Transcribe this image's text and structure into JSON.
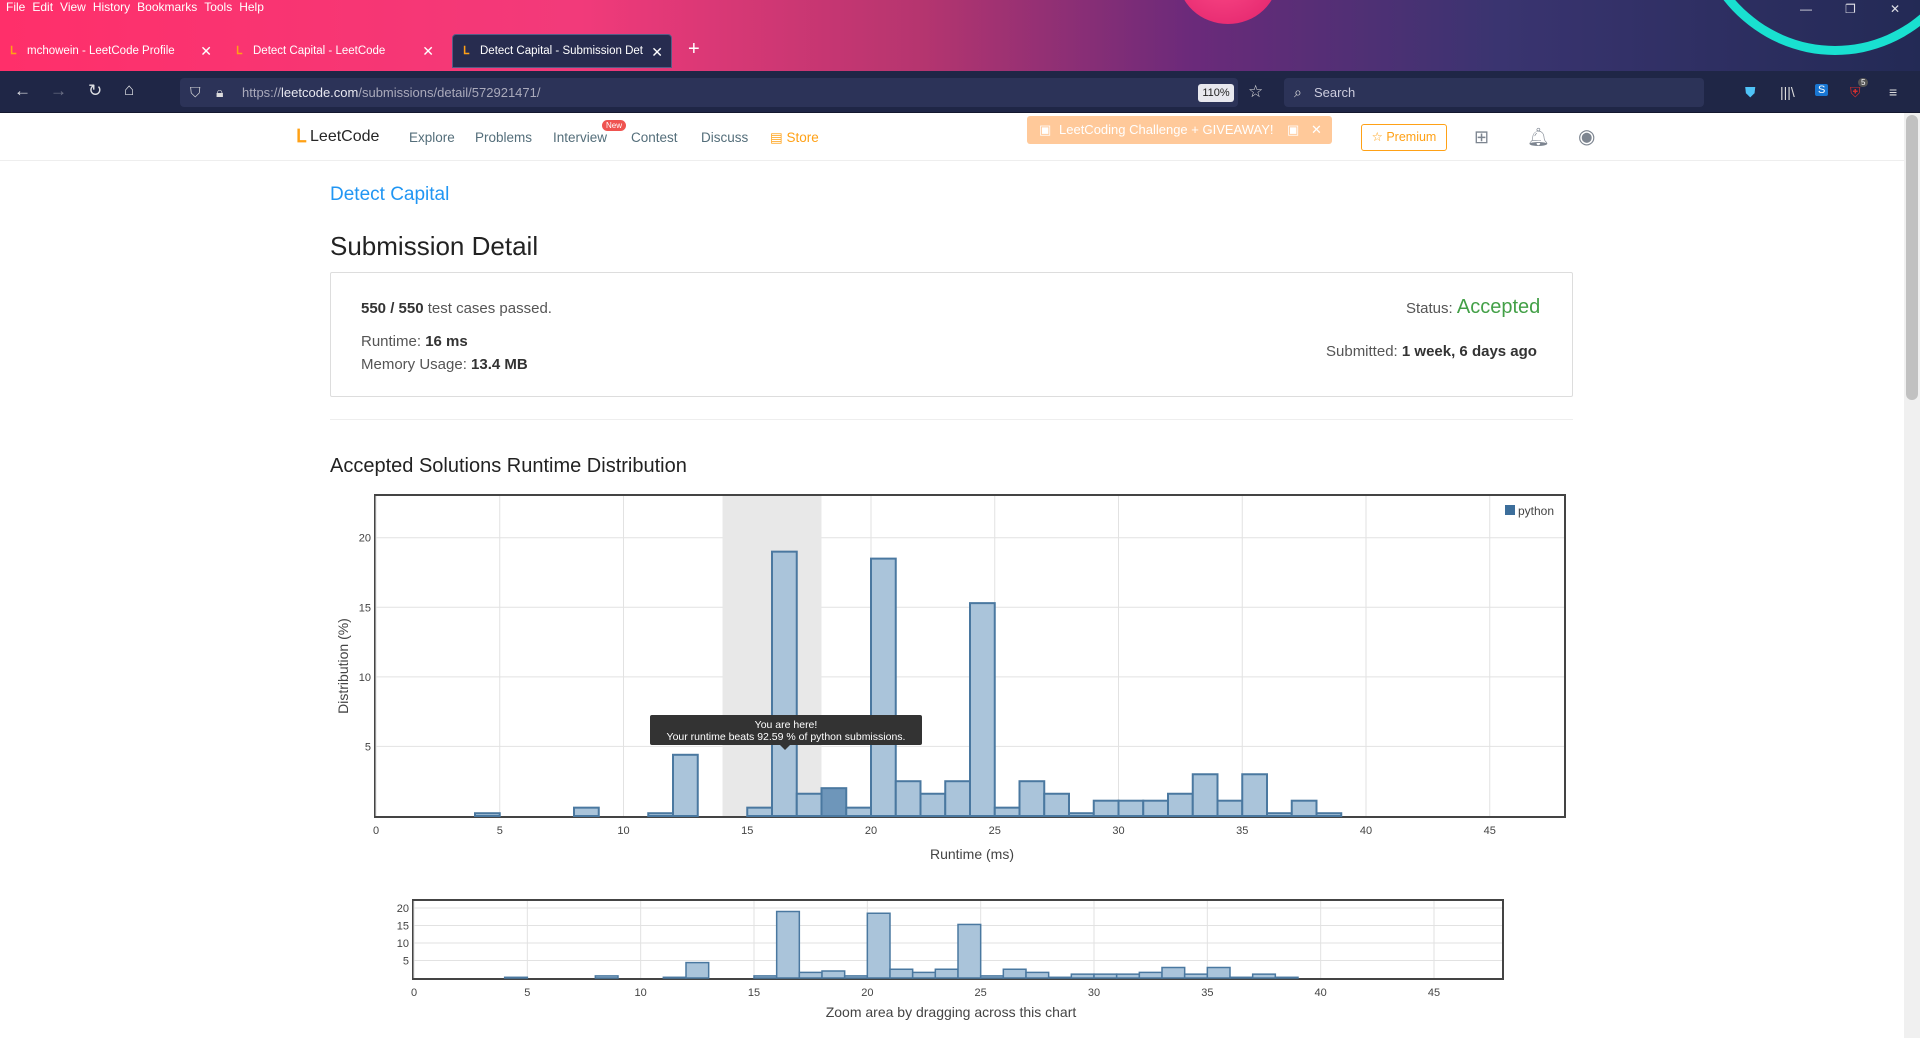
{
  "browser": {
    "menu": [
      "File",
      "Edit",
      "View",
      "History",
      "Bookmarks",
      "Tools",
      "Help"
    ],
    "tabs": [
      {
        "title": "mchowein - LeetCode Profile"
      },
      {
        "title": "Detect Capital - LeetCode"
      },
      {
        "title": "Detect Capital - Submission Det"
      }
    ],
    "url_prefix": "https://",
    "url_host": "leetcode.com",
    "url_path": "/submissions/detail/572921471/",
    "zoom": "110%",
    "search_placeholder": "Search",
    "notif_count": "5"
  },
  "site": {
    "logo": "LeetCode",
    "nav": [
      "Explore",
      "Problems",
      "Interview",
      "Contest",
      "Discuss"
    ],
    "new_badge": "New",
    "store": "Store",
    "promo": "LeetCoding Challenge + GIVEAWAY!",
    "premium": "Premium"
  },
  "problem_title": "Detect Capital",
  "page_heading": "Submission Detail",
  "result": {
    "cases_passed": "550 / 550",
    "cases_suffix": "test cases passed.",
    "status_label": "Status:",
    "status": "Accepted",
    "runtime_label": "Runtime:",
    "runtime": "16 ms",
    "memory_label": "Memory Usage:",
    "memory": "13.4 MB",
    "submitted_label": "Submitted:",
    "submitted": "1 week, 6 days ago"
  },
  "dist_heading": "Accepted Solutions Runtime Distribution",
  "tooltip": {
    "line1": "You are here!",
    "line2": "Your runtime beats 92.59 % of python submissions."
  },
  "chart_data": [
    {
      "type": "bar",
      "title": "",
      "xlabel": "Runtime (ms)",
      "ylabel": "Distribution (%)",
      "xlim": [
        0,
        48
      ],
      "ylim": [
        0,
        23
      ],
      "xticks": [
        0,
        5,
        10,
        15,
        20,
        25,
        30,
        35,
        40,
        45
      ],
      "yticks": [
        5,
        10,
        15,
        20
      ],
      "legend": "top-right",
      "highlight_range": [
        14,
        18
      ],
      "current_bar": 18,
      "colors": {
        "bar_fill": "#aac4da",
        "bar_stroke": "#4a78a0",
        "current_fill": "#6e96ba",
        "highlight": "#e8e8e8"
      },
      "series": [
        {
          "name": "python",
          "x": [
            4,
            8,
            11,
            12,
            15,
            16,
            17,
            18,
            19,
            20,
            21,
            22,
            23,
            24,
            25,
            26,
            27,
            28,
            29,
            30,
            31,
            32,
            33,
            34,
            35,
            36,
            37,
            38
          ],
          "values": [
            0.2,
            0.6,
            0.2,
            4.4,
            0.6,
            19,
            1.6,
            2,
            0.6,
            18.5,
            2.5,
            1.6,
            2.5,
            15.3,
            0.6,
            2.5,
            1.6,
            0.2,
            1.1,
            1.1,
            1.1,
            1.6,
            3,
            1.1,
            3,
            0.2,
            1.1,
            0.2
          ]
        }
      ]
    },
    {
      "type": "bar",
      "xlabel": "Zoom area by dragging across this chart",
      "xlim": [
        0,
        48
      ],
      "ylim": [
        0,
        22
      ],
      "xticks": [
        0,
        5,
        10,
        15,
        20,
        25,
        30,
        35,
        40,
        45
      ],
      "yticks": [
        5,
        10,
        15,
        20
      ],
      "series": [
        {
          "name": "python",
          "x": [
            4,
            8,
            11,
            12,
            15,
            16,
            17,
            18,
            19,
            20,
            21,
            22,
            23,
            24,
            25,
            26,
            27,
            28,
            29,
            30,
            31,
            32,
            33,
            34,
            35,
            36,
            37,
            38
          ],
          "values": [
            0.2,
            0.6,
            0.2,
            4.4,
            0.6,
            19,
            1.6,
            2,
            0.6,
            18.5,
            2.5,
            1.6,
            2.5,
            15.3,
            0.6,
            2.5,
            1.6,
            0.2,
            1.1,
            1.1,
            1.1,
            1.6,
            3,
            1.1,
            3,
            0.2,
            1.1,
            0.2
          ]
        }
      ]
    }
  ]
}
